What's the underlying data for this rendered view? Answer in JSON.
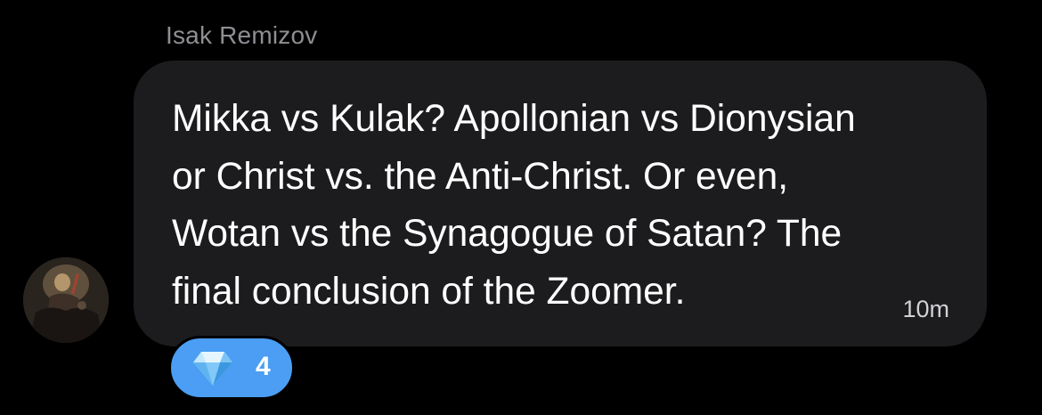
{
  "message": {
    "sender_name": "Isak Remizov",
    "text": "Mikka vs Kulak? Apollonian vs Dionysian\nor Christ vs. the Anti-Christ. Or even,\nWotan vs the Synagogue of Satan? The\nfinal conclusion of the Zoomer.",
    "timestamp": "10m"
  },
  "reaction": {
    "icon": "gem-icon",
    "count": "4"
  },
  "colors": {
    "background": "#000000",
    "bubble": "#1c1c1e",
    "reaction_pill": "#4b9ef3",
    "sender_name": "#8e8e93"
  }
}
